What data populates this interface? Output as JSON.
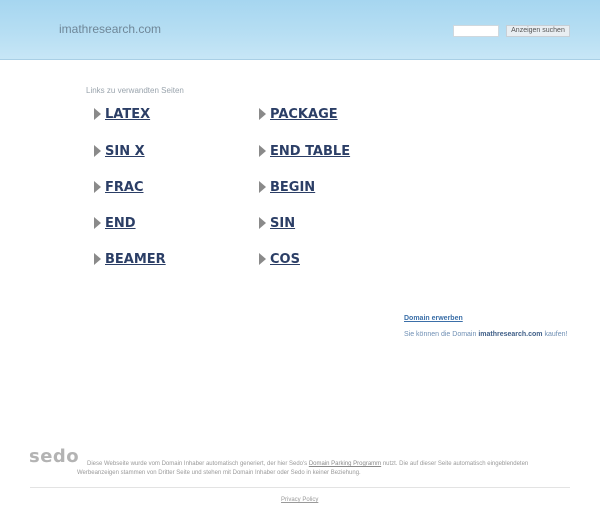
{
  "header": {
    "site_title": "imathresearch.com",
    "search_placeholder": "",
    "search_button_label": "Anzeigen suchen"
  },
  "related": {
    "label": "Links zu verwandten Seiten",
    "links": [
      "LATEX",
      "PACKAGE",
      "SIN X",
      "END TABLE",
      "FRAC",
      "BEGIN",
      "END",
      "SIN",
      "BEAMER",
      "COS"
    ]
  },
  "domain": {
    "buy_label": "Domain erwerben",
    "text_prefix": "Sie können die Domain ",
    "domain_name": "imathresearch.com",
    "text_suffix": " kaufen!"
  },
  "footer": {
    "logo": "sedo",
    "disclaimer_part1": "Diese Webseite wurde vom Domain Inhaber automatisch generiert, der hier Sedo's ",
    "disclaimer_link": "Domain Parking Programm",
    "disclaimer_part2": " nutzt. Die auf dieser Seite automatisch eingeblendeten",
    "disclaimer_line2": "Werbeanzeigen stammen von Dritter Seite und stehen mit Domain Inhaber oder Sedo in keiner Beziehung.",
    "privacy_label": "Privacy Policy"
  },
  "colors": {
    "header_gradient_top": "#a6d6f0",
    "link_color": "#2b3e66",
    "arrow_color": "#8a8a8a"
  }
}
